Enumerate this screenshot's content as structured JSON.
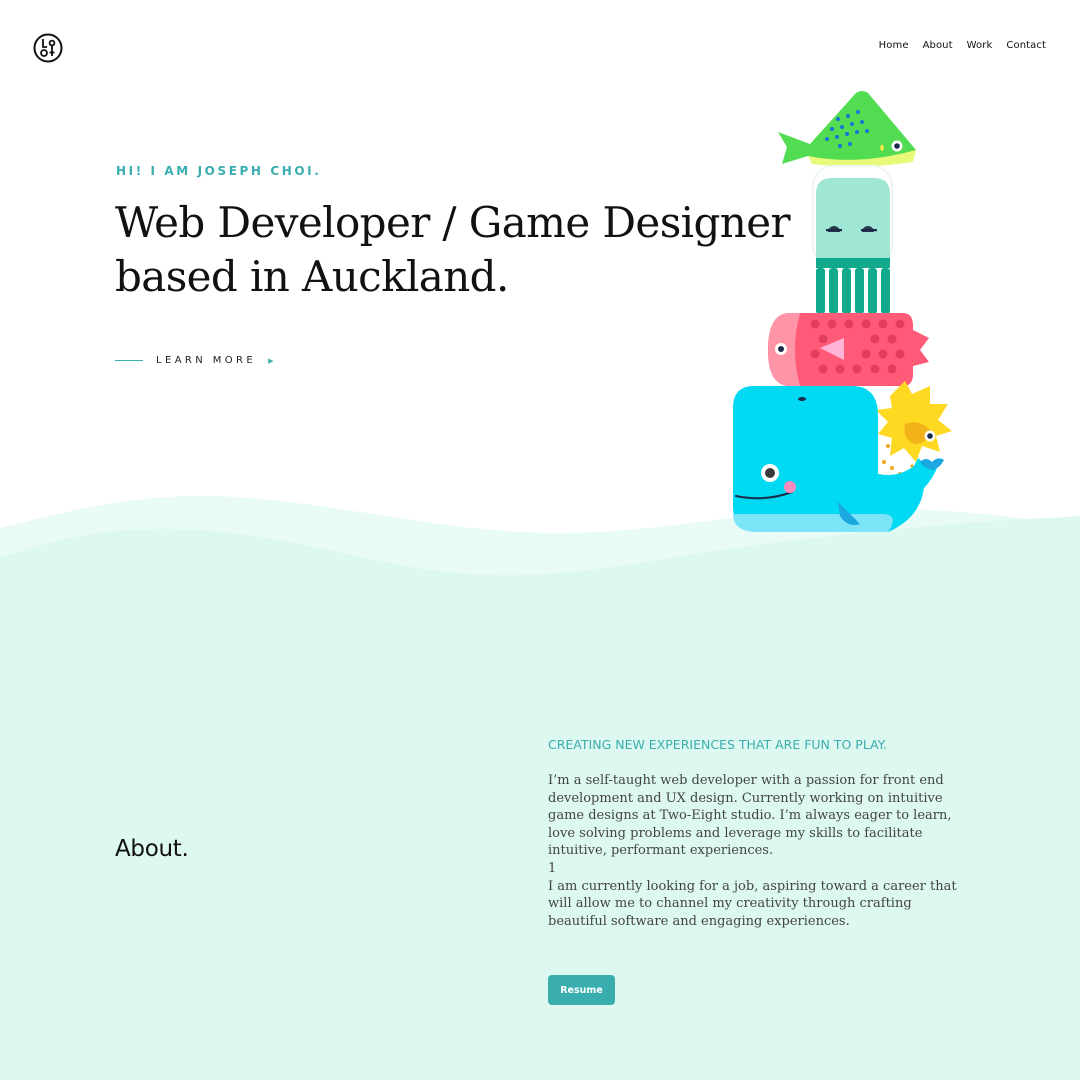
{
  "header": {
    "logo_icon": "monogram-logo-icon",
    "nav": [
      "Home",
      "About",
      "Work",
      "Contact"
    ]
  },
  "hero": {
    "eyebrow": "HI! I AM JOSEPH CHOI.",
    "headline": "Web Developer / Game Designer\nbased in Auckland.",
    "cta_label": "LEARN MORE",
    "cta_arrow_icon": "triangle-right-icon",
    "illustration_icon": "stacked-sea-creatures-illustration"
  },
  "about": {
    "heading": "About.",
    "subheading": "CREATING NEW EXPERIENCES THAT ARE FUN TO PLAY.",
    "body": "I’m a self-taught web developer with a passion for front end development and UX design. Currently working on intuitive game designs at Two-Eight studio. I’m always eager to learn, love solving problems and leverage my skills to facilitate intuitive, performant experiences.\n1\nI am currently looking for a job, aspiring toward a career that will allow me to channel my creativity through crafting beautiful software and engaging experiences.",
    "resume_label": "Resume"
  },
  "colors": {
    "accent": "#3aaeae",
    "sea": "#dcf8f0",
    "whale": "#00d9f2",
    "fish_pink": "#ff5a78",
    "fish_green": "#52dc52",
    "octopus_head": "#a0e6d4",
    "octopus_legs": "#12aa8c",
    "pufferfish": "#ffd822"
  }
}
